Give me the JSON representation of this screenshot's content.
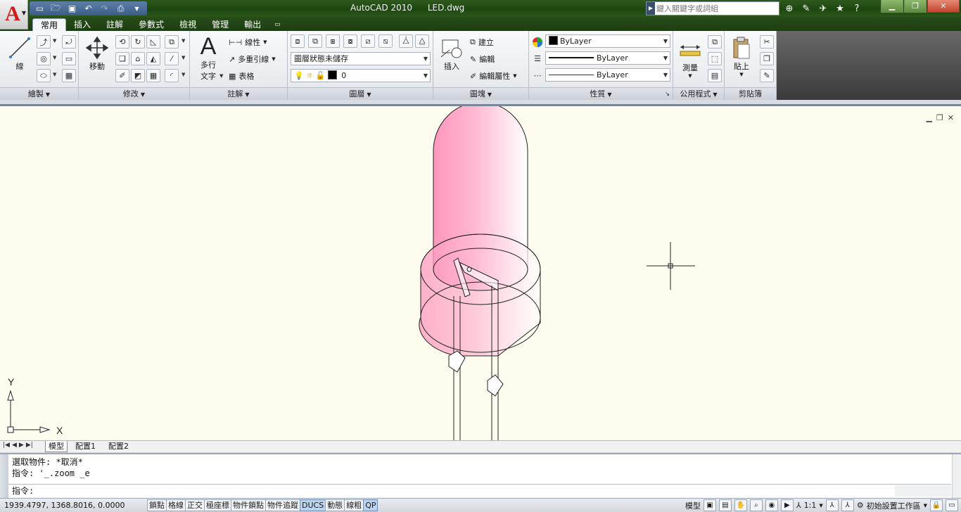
{
  "app": {
    "title": "AutoCAD 2010",
    "file": "LED.dwg",
    "logo_letter": "A"
  },
  "search": {
    "placeholder": "鍵入關鍵字或詞組"
  },
  "quick_access": [
    "new-icon",
    "open-icon",
    "save-icon",
    "undo-icon",
    "redo-icon",
    "print-icon"
  ],
  "tabs": [
    {
      "label": "常用",
      "active": true
    },
    {
      "label": "插入"
    },
    {
      "label": "註解"
    },
    {
      "label": "參數式"
    },
    {
      "label": "檢視"
    },
    {
      "label": "管理"
    },
    {
      "label": "輸出"
    }
  ],
  "ribbon": {
    "draw": {
      "title": "繪製",
      "line_label": "線"
    },
    "modify": {
      "title": "修改",
      "move_label": "移動"
    },
    "annotation": {
      "title": "註解",
      "mtext_label": "多行\n文字",
      "mtext_line1": "多行",
      "mtext_line2": "文字",
      "dim_label": "線性",
      "mleader_label": "多重引線",
      "table_label": "表格"
    },
    "layers": {
      "title": "圖層",
      "layer_state": "圖層狀態未儲存",
      "current_layer": "0"
    },
    "block": {
      "title": "圖塊",
      "insert_label": "插入",
      "create_label": "建立",
      "edit_label": "編輯",
      "edit_attr_label": "編輯屬性"
    },
    "properties": {
      "title": "性質",
      "color": "ByLayer",
      "lineweight": "ByLayer",
      "linetype": "ByLayer"
    },
    "utilities": {
      "title": "公用程式",
      "measure_label": "測量"
    },
    "clipboard": {
      "title": "剪貼簿",
      "paste_label": "貼上"
    }
  },
  "viewport": {
    "ucs_x": "X",
    "ucs_y": "Y"
  },
  "layout_tabs": [
    "模型",
    "配置1",
    "配置2"
  ],
  "command": {
    "history": [
      "選取物件: *取消*",
      "指令: '_.zoom _e"
    ],
    "prompt": "指令:"
  },
  "status": {
    "coordinates": "1939.4797, 1368.8016, 0.0000",
    "toggles": [
      {
        "label": "鎖點",
        "on": false
      },
      {
        "label": "格線",
        "on": false
      },
      {
        "label": "正交",
        "on": false
      },
      {
        "label": "極座標",
        "on": false
      },
      {
        "label": "物件鎖點",
        "on": false
      },
      {
        "label": "物件追蹤",
        "on": false
      },
      {
        "label": "DUCS",
        "on": true
      },
      {
        "label": "動態",
        "on": false
      },
      {
        "label": "線粗",
        "on": false
      },
      {
        "label": "QP",
        "on": true
      }
    ],
    "model_label": "模型",
    "annotation_scale": "1:1",
    "workspace": "初始設置工作區"
  },
  "colors": {
    "canvas_bg": "#fefcee",
    "led_pink": "#ff9ec4",
    "titlebar_green": "#234d15"
  }
}
